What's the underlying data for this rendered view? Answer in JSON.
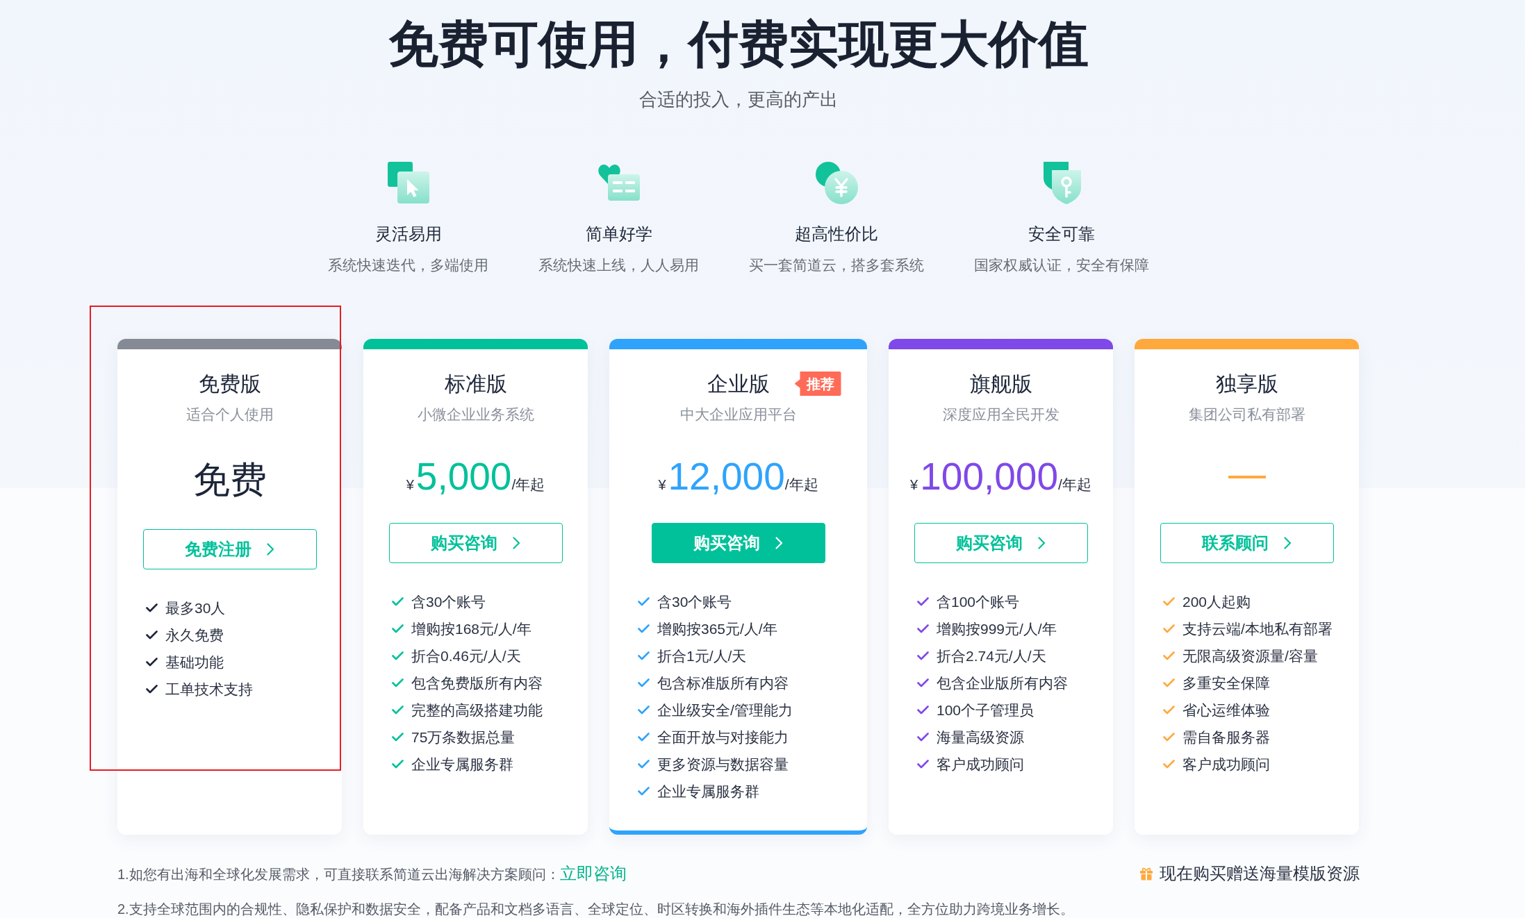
{
  "header": {
    "title": "免费可使用，付费实现更大价值",
    "subtitle": "合适的投入，更高的产出"
  },
  "features": [
    {
      "title": "灵活易用",
      "description": "系统快速迭代，多端使用"
    },
    {
      "title": "简单好学",
      "description": "系统快速上线，人人易用"
    },
    {
      "title": "超高性价比",
      "description": "买一套简道云，搭多套系统"
    },
    {
      "title": "安全可靠",
      "description": "国家权威认证，安全有保障"
    }
  ],
  "plans": [
    {
      "name": "免费版",
      "subtitle": "适合个人使用",
      "bar": {
        "color": "#858a94"
      },
      "color": "#1c2538",
      "featured": false,
      "highlighted": true,
      "price": {
        "kind": "text",
        "text": "免费"
      },
      "button": {
        "label": "免费注册",
        "filled": false
      },
      "features": [
        "最多30人",
        "永久免费",
        "基础功能",
        "工单技术支持"
      ]
    },
    {
      "name": "标准版",
      "subtitle": "小微企业业务系统",
      "bar": {
        "color": "#00c19a"
      },
      "color": "#00c19a",
      "featured": false,
      "highlighted": false,
      "price": {
        "kind": "amount",
        "currency": "¥",
        "amount": "5,000",
        "unit": "/年起"
      },
      "button": {
        "label": "购买咨询",
        "filled": false
      },
      "features": [
        "含30个账号",
        "增购按168元/人/年",
        "折合0.46元/人/天",
        "包含免费版所有内容",
        "完整的高级搭建功能",
        "75万条数据总量",
        "企业专属服务群"
      ]
    },
    {
      "name": "企业版",
      "badge": "推荐",
      "subtitle": "中大企业应用平台",
      "bar": {
        "color": "#2fa3fc"
      },
      "color": "#2fa3fc",
      "featured": true,
      "highlighted": false,
      "price": {
        "kind": "amount",
        "currency": "¥",
        "amount": "12,000",
        "unit": "/年起"
      },
      "button": {
        "label": "购买咨询",
        "filled": true
      },
      "features": [
        "含30个账号",
        "增购按365元/人/年",
        "折合1元/人/天",
        "包含标准版所有内容",
        "企业级安全/管理能力",
        "全面开放与对接能力",
        "更多资源与数据容量",
        "企业专属服务群"
      ]
    },
    {
      "name": "旗舰版",
      "subtitle": "深度应用全民开发",
      "bar": {
        "color": "#7f48e8"
      },
      "color": "#7f48e8",
      "featured": false,
      "highlighted": false,
      "price": {
        "kind": "amount",
        "currency": "¥",
        "amount": "100,000",
        "unit": "/年起"
      },
      "button": {
        "label": "购买咨询",
        "filled": false
      },
      "features": [
        "含100个账号",
        "增购按999元/人/年",
        "折合2.74元/人/天",
        "包含企业版所有内容",
        "100个子管理员",
        "海量高级资源",
        "客户成功顾问"
      ]
    },
    {
      "name": "独享版",
      "subtitle": "集团公司私有部署",
      "bar": {
        "color": "#ffa93d"
      },
      "color": "#ffa93d",
      "featured": false,
      "highlighted": false,
      "price": {
        "kind": "dash"
      },
      "button": {
        "label": "联系顾问",
        "filled": false
      },
      "features": [
        "200人起购",
        "支持云端/本地私有部署",
        "无限高级资源量/容量",
        "多重安全保障",
        "省心运维体验",
        "需自备服务器",
        "客户成功顾问"
      ]
    }
  ],
  "notes": [
    {
      "text": "1.如您有出海和全球化发展需求，可直接联系简道云出海解决方案顾问：",
      "link": "立即咨询"
    },
    {
      "text": "2.支持全球范围内的合规性、隐私保护和数据安全，配备产品和文档多语言、全球定位、时区转换和海外插件生态等本地化适配，全方位助力跨境业务增长。"
    }
  ],
  "promo": {
    "text": "现在购买赠送海量模版资源"
  }
}
